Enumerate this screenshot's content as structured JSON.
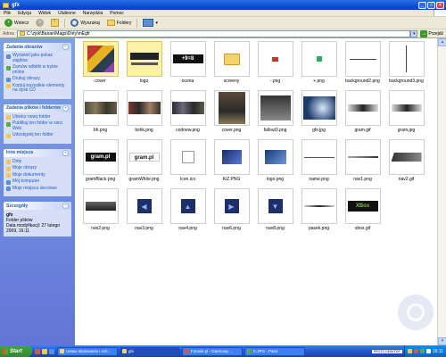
{
  "window": {
    "title": "gfx"
  },
  "menu": [
    "Plik",
    "Edycja",
    "Widok",
    "Ulubione",
    "Narzędzia",
    "Pomoc"
  ],
  "toolbar": {
    "back": "Wstecz",
    "search": "Wyszukaj",
    "folders": "Foldery"
  },
  "address": {
    "label": "Adres",
    "path": "C:\\zjsk\\Banan\\Mags\\Dirty\\mEgfr",
    "go": "Przejdź"
  },
  "sidebar": {
    "tasks_title": "Zadania obrazów",
    "tasks": [
      "Wyświetl jako pokaz slajdów",
      "Zamów odbitki w trybie online",
      "Drukuj obrazy",
      "Kopiuj wszystkie elementy na dysk CD"
    ],
    "file_tasks_title": "Zadania plików i folderów",
    "file_tasks": [
      "Utwórz nowy folder",
      "Publikuj ten folder w sieci Web",
      "Udostępnij ten folder"
    ],
    "other_title": "Inne miejsca",
    "other": [
      "Dirty",
      "Moje obrazy",
      "Moje dokumenty",
      "Mój komputer",
      "Moje miejsca sieciowe"
    ],
    "details_title": "Szczegóły",
    "details": {
      "name": "gfx",
      "type": "Folder plików",
      "modified": "Data modyfikacji: 27 lutego 2009, 16:11"
    }
  },
  "files": [
    {
      "name": "cover",
      "thumb": "cover"
    },
    {
      "name": "logo",
      "thumb": "logo"
    },
    {
      "name": "ocena",
      "thumb": "ocena",
      "text": "+9=8"
    },
    {
      "name": "screeny",
      "thumb": "folder"
    },
    {
      "name": "-.png",
      "thumb": "minus"
    },
    {
      "name": "+.png",
      "thumb": "plus"
    },
    {
      "name": "background2.png",
      "thumb": "bg2"
    },
    {
      "name": "background3.png",
      "thumb": "bg3"
    },
    {
      "name": "bh.png",
      "thumb": "photo"
    },
    {
      "name": "bshk.png",
      "thumb": "photo2"
    },
    {
      "name": "codnew.png",
      "thumb": "photo3"
    },
    {
      "name": "cover.png",
      "thumb": "coverphoto"
    },
    {
      "name": "fallout3.png",
      "thumb": "fallout"
    },
    {
      "name": "gfx.jpg",
      "thumb": "gfxjpg"
    },
    {
      "name": "gram.gif",
      "thumb": "gramart"
    },
    {
      "name": "gram.jpg",
      "thumb": "gramart"
    },
    {
      "name": "gramBlack.png",
      "thumb": "gramlogo",
      "text": "gram.pl"
    },
    {
      "name": "gramWhite.png",
      "thumb": "gramlogowhite",
      "text": "gram.pl"
    },
    {
      "name": "Icon.ico",
      "thumb": "iconblank"
    },
    {
      "name": "KiZ.PNG",
      "thumb": "kiz"
    },
    {
      "name": "logo.png",
      "thumb": "logopng"
    },
    {
      "name": "name.png",
      "thumb": "thinline"
    },
    {
      "name": "nav1.png",
      "thumb": "thinline2"
    },
    {
      "name": "nav2.gif",
      "thumb": "navdark2"
    },
    {
      "name": "nav2.png",
      "thumb": "navdark"
    },
    {
      "name": "nav3.png",
      "thumb": "arrowleft"
    },
    {
      "name": "nav4.png",
      "thumb": "arrowup"
    },
    {
      "name": "nav6.png",
      "thumb": "arrowright"
    },
    {
      "name": "nav8.png",
      "thumb": "arrowdown"
    },
    {
      "name": "pasek.png",
      "thumb": "pasek"
    },
    {
      "name": "xbox.gif",
      "thumb": "xbox",
      "text": "XBox"
    }
  ],
  "taskbar": {
    "start": "Start",
    "tasks": [
      {
        "label": "Ustaw skalowanie i sch...",
        "active": false
      },
      {
        "label": "gfx",
        "active": true
      },
      {
        "label": "Fotosik.pl - Darmowy ...",
        "active": false
      },
      {
        "label": "K.JPG - Paint",
        "active": false
      }
    ],
    "lang": "PROTO DESKTOP",
    "clock": "16:11"
  },
  "colors": {
    "titlebar": "#0a4ed0",
    "taskpane": "#7ba2e7",
    "taskbar": "#245edb",
    "start": "#3c9a2b"
  }
}
